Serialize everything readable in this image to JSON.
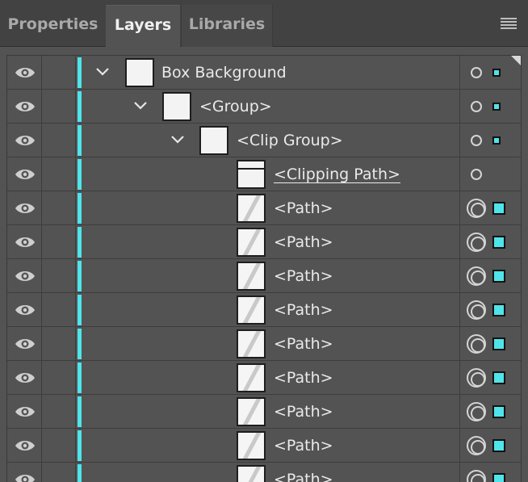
{
  "tabs": [
    {
      "label": "Properties",
      "active": false
    },
    {
      "label": "Layers",
      "active": true
    },
    {
      "label": "Libraries",
      "active": false
    }
  ],
  "layer_color": "#4fe4ea",
  "layers": [
    {
      "name": "Box Background",
      "depth": 0,
      "expanded": true,
      "thumb": "box",
      "target": "single",
      "selection": "small",
      "underlined": false
    },
    {
      "name": "<Group>",
      "depth": 1,
      "expanded": true,
      "thumb": "box",
      "target": "single",
      "selection": "small",
      "underlined": false
    },
    {
      "name": "<Clip Group>",
      "depth": 2,
      "expanded": true,
      "thumb": "box",
      "target": "single",
      "selection": "small",
      "underlined": false
    },
    {
      "name": "<Clipping Path>",
      "depth": 3,
      "expanded": null,
      "thumb": "clip",
      "target": "single",
      "selection": "none",
      "underlined": true
    },
    {
      "name": "<Path>",
      "depth": 3,
      "expanded": null,
      "thumb": "path",
      "target": "double",
      "selection": "big",
      "underlined": false
    },
    {
      "name": "<Path>",
      "depth": 3,
      "expanded": null,
      "thumb": "path",
      "target": "double",
      "selection": "big",
      "underlined": false
    },
    {
      "name": "<Path>",
      "depth": 3,
      "expanded": null,
      "thumb": "path",
      "target": "double",
      "selection": "big",
      "underlined": false
    },
    {
      "name": "<Path>",
      "depth": 3,
      "expanded": null,
      "thumb": "path",
      "target": "double",
      "selection": "big",
      "underlined": false
    },
    {
      "name": "<Path>",
      "depth": 3,
      "expanded": null,
      "thumb": "path",
      "target": "double",
      "selection": "big",
      "underlined": false
    },
    {
      "name": "<Path>",
      "depth": 3,
      "expanded": null,
      "thumb": "path",
      "target": "double",
      "selection": "big",
      "underlined": false
    },
    {
      "name": "<Path>",
      "depth": 3,
      "expanded": null,
      "thumb": "path",
      "target": "double",
      "selection": "big",
      "underlined": false
    },
    {
      "name": "<Path>",
      "depth": 3,
      "expanded": null,
      "thumb": "path",
      "target": "double",
      "selection": "big",
      "underlined": false
    },
    {
      "name": "<Path>",
      "depth": 3,
      "expanded": null,
      "thumb": "path",
      "target": "double",
      "selection": "big",
      "underlined": false
    }
  ]
}
